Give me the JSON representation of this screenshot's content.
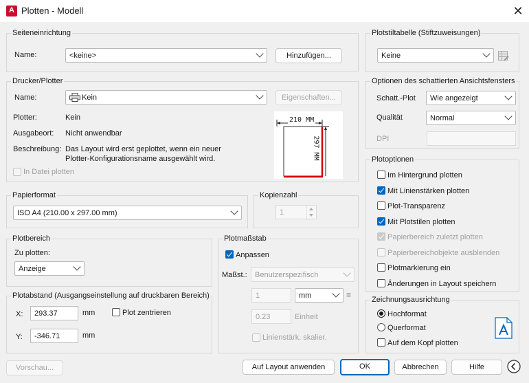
{
  "window": {
    "title": "Plotten - Modell",
    "app_icon": "A"
  },
  "page_setup": {
    "group_label": "Seiteneinrichtung",
    "name_label": "Name:",
    "name_value": "<keine>",
    "add_button": "Hinzufügen..."
  },
  "printer": {
    "group_label": "Drucker/Plotter",
    "name_label": "Name:",
    "name_value": "Kein",
    "properties_button": "Eigenschaften...",
    "plotter_label": "Plotter:",
    "plotter_value": "Kein",
    "location_label": "Ausgabeort:",
    "location_value": "Nicht anwendbar",
    "description_label": "Beschreibung:",
    "description_line1": "Das Layout wird erst geplottet, wenn ein neuer",
    "description_line2": "Plotter-Konfigurationsname ausgewählt wird.",
    "plot_to_file": "In Datei plotten",
    "preview_width": "210  MM",
    "preview_height": "297  MM"
  },
  "paper_size": {
    "group_label": "Papierformat",
    "value": "ISO A4 (210.00 x 297.00 mm)"
  },
  "copies": {
    "group_label": "Kopienzahl",
    "value": "1"
  },
  "plot_area": {
    "group_label": "Plotbereich",
    "what_label": "Zu plotten:",
    "value": "Anzeige"
  },
  "plot_offset": {
    "group_label": "Plotabstand (Ausgangseinstellung auf druckbaren Bereich)",
    "x_label": "X:",
    "x_value": "293.37",
    "x_unit": "mm",
    "y_label": "Y:",
    "y_value": "-346.71",
    "y_unit": "mm",
    "center_label": "Plot zentrieren"
  },
  "plot_scale": {
    "group_label": "Plotmaßstab",
    "fit_label": "Anpassen",
    "scale_label": "Maßst.:",
    "scale_value": "Benutzerspezifisch",
    "value1": "1",
    "unit_value": "mm",
    "equals": "=",
    "value2": "0.23",
    "unit2": "Einheit",
    "scale_lineweights": "Linienstärk. skalier."
  },
  "style_table": {
    "group_label": "Plotstiltabelle (Stiftzuweisungen)",
    "value": "Keine",
    "edit_icon": "edit-table-icon"
  },
  "shaded_viewport": {
    "group_label": "Optionen des schattierten Ansichtsfensters",
    "shade_label": "Schatt.-Plot",
    "shade_value": "Wie angezeigt",
    "quality_label": "Qualität",
    "quality_value": "Normal",
    "dpi_label": "DPI"
  },
  "plot_options": {
    "group_label": "Plotoptionen",
    "items": [
      {
        "label": "Im Hintergrund plotten",
        "checked": false,
        "disabled": false
      },
      {
        "label": "Mit Linienstärken plotten",
        "checked": true,
        "disabled": false
      },
      {
        "label": "Plot-Transparenz",
        "checked": false,
        "disabled": false
      },
      {
        "label": "Mit Plotstilen plotten",
        "checked": true,
        "disabled": false
      },
      {
        "label": "Papierbereich zuletzt plotten",
        "checked": true,
        "disabled": true
      },
      {
        "label": "Papierbereichobjekte ausblenden",
        "checked": false,
        "disabled": true
      },
      {
        "label": "Plotmarkierung ein",
        "checked": false,
        "disabled": false
      },
      {
        "label": "Änderungen in Layout speichern",
        "checked": false,
        "disabled": false
      }
    ]
  },
  "orientation": {
    "group_label": "Zeichnungsausrichtung",
    "portrait": "Hochformat",
    "landscape": "Querformat",
    "upside_down": "Auf dem Kopf plotten",
    "selected": "Hochformat"
  },
  "footer": {
    "preview": "Vorschau...",
    "apply": "Auf Layout anwenden",
    "ok": "OK",
    "cancel": "Abbrechen",
    "help": "Hilfe",
    "collapse_icon": "chevron-left-circle-icon"
  },
  "colors": {
    "accent": "#0067c0",
    "red": "#d00000"
  }
}
